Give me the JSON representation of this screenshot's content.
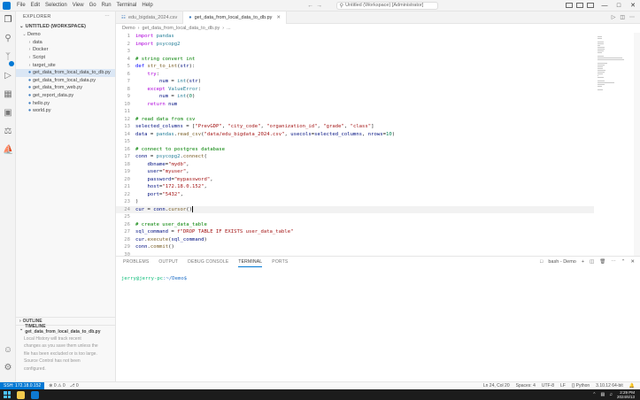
{
  "titlebar": {
    "menu": [
      "File",
      "Edit",
      "Selection",
      "View",
      "Go",
      "Run",
      "Terminal",
      "Help"
    ],
    "search": "Untitled (Workspace) [Administrator]"
  },
  "sidebar": {
    "header": "EXPLORER",
    "section": "UNTITLED (WORKSPACE)",
    "items": [
      {
        "label": "Demo",
        "indent": 1,
        "type": "folder-open"
      },
      {
        "label": "data",
        "indent": 2,
        "type": "folder"
      },
      {
        "label": "Docker",
        "indent": 2,
        "type": "folder"
      },
      {
        "label": "Script",
        "indent": 2,
        "type": "folder"
      },
      {
        "label": "target_site",
        "indent": 2,
        "type": "folder"
      },
      {
        "label": "get_data_from_local_data_to_db.py",
        "indent": 2,
        "type": "file",
        "selected": true
      },
      {
        "label": "get_data_from_local_data.py",
        "indent": 2,
        "type": "file"
      },
      {
        "label": "get_data_from_web.py",
        "indent": 2,
        "type": "file"
      },
      {
        "label": "get_report_data.py",
        "indent": 2,
        "type": "file"
      },
      {
        "label": "hello.py",
        "indent": 2,
        "type": "file"
      },
      {
        "label": "world.py",
        "indent": 2,
        "type": "file"
      }
    ],
    "outline": "OUTLINE",
    "timeline": "TIMELINE  get_data_from_local_data_to_db.py",
    "timeline_message": [
      "Local History will track recent",
      "changes as you save them unless the",
      "file has been excluded or is too large.",
      "Source Control has not been",
      "configured."
    ]
  },
  "tabs": [
    {
      "label": "edu_bigdata_2024.csv",
      "active": false
    },
    {
      "label": "get_data_from_local_data_to_db.py",
      "active": true
    }
  ],
  "breadcrumb": [
    "Demo",
    "get_data_from_local_data_to_db.py",
    "..."
  ],
  "code": [
    {
      "n": "1",
      "html": "<span class='c-kw'>import</span> <span class='c-mod'>pandas</span>"
    },
    {
      "n": "2",
      "html": "<span class='c-kw'>import</span> <span class='c-mod'>psycopg2</span>"
    },
    {
      "n": "3",
      "html": ""
    },
    {
      "n": "4",
      "html": "<span class='c-cm'># string convert int</span>"
    },
    {
      "n": "5",
      "html": "<span class='c-kw2'>def</span> <span class='c-fn'>str_to_int</span>(<span class='c-var'>str</span>):"
    },
    {
      "n": "6",
      "html": "    <span class='c-kw'>try</span>:"
    },
    {
      "n": "7",
      "html": "        <span class='c-var'>num</span> = <span class='c-mod'>int</span>(<span class='c-var'>str</span>)"
    },
    {
      "n": "8",
      "html": "    <span class='c-kw'>except</span> <span class='c-mod'>ValueError</span>:"
    },
    {
      "n": "9",
      "html": "        <span class='c-var'>num</span> = <span class='c-mod'>int</span>(<span class='c-num'>0</span>)"
    },
    {
      "n": "10",
      "html": "    <span class='c-kw'>return</span> <span class='c-var'>num</span>"
    },
    {
      "n": "11",
      "html": ""
    },
    {
      "n": "12",
      "html": "<span class='c-cm'># read data from csv</span>"
    },
    {
      "n": "13",
      "html": "<span class='c-var'>selected_columns</span> = [<span class='c-str'>\"PrevGDP\"</span>, <span class='c-str'>\"city_code\"</span>, <span class='c-str'>\"organization_id\"</span>, <span class='c-str'>\"grade\"</span>, <span class='c-str'>\"class\"</span>]"
    },
    {
      "n": "14",
      "html": "<span class='c-var'>data</span> = <span class='c-mod'>pandas</span>.<span class='c-fn'>read_csv</span>(<span class='c-str'>\"data/edu_bigdata_2024.csv\"</span>, <span class='c-var'>usecols</span>=<span class='c-var'>selected_columns</span>, <span class='c-var'>nrows</span>=<span class='c-num'>10</span>)"
    },
    {
      "n": "15",
      "html": ""
    },
    {
      "n": "16",
      "html": "<span class='c-cm'># connect to postgres database</span>"
    },
    {
      "n": "17",
      "html": "<span class='c-var'>conn</span> = <span class='c-mod'>psycopg2</span>.<span class='c-fn'>connect</span>("
    },
    {
      "n": "18",
      "html": "    <span class='c-var'>dbname</span>=<span class='c-str'>\"mydb\"</span>,"
    },
    {
      "n": "19",
      "html": "    <span class='c-var'>user</span>=<span class='c-str'>\"myuser\"</span>,"
    },
    {
      "n": "20",
      "html": "    <span class='c-var'>password</span>=<span class='c-str'>\"mypassword\"</span>,"
    },
    {
      "n": "21",
      "html": "    <span class='c-var'>host</span>=<span class='c-str'>\"172.18.0.152\"</span>,"
    },
    {
      "n": "22",
      "html": "    <span class='c-var'>port</span>=<span class='c-str'>\"5432\"</span>,"
    },
    {
      "n": "23",
      "html": ")"
    },
    {
      "n": "24",
      "html": "<span class='c-var'>cur</span> = <span class='c-var'>conn</span>.<span class='c-fn'>cursor</span>()<span class='cursor'></span>",
      "current": true
    },
    {
      "n": "25",
      "html": ""
    },
    {
      "n": "26",
      "html": "<span class='c-cm'># create user_data_table</span>"
    },
    {
      "n": "27",
      "html": "<span class='c-var'>sql_command</span> = <span class='c-str'>f\"DROP TABLE IF EXISTS user_data_table\"</span>"
    },
    {
      "n": "28",
      "html": "<span class='c-var'>cur</span>.<span class='c-fn'>execute</span>(<span class='c-var'>sql_command</span>)"
    },
    {
      "n": "29",
      "html": "<span class='c-var'>conn</span>.<span class='c-fn'>commit</span>()"
    },
    {
      "n": "30",
      "html": ""
    },
    {
      "n": "31",
      "html": "<span class='c-var'>sql_command</span> = <span class='c-str'>f'''</span>"
    }
  ],
  "panel": {
    "tabs": [
      "PROBLEMS",
      "OUTPUT",
      "DEBUG CONSOLE",
      "TERMINAL",
      "PORTS"
    ],
    "active_tab": "TERMINAL",
    "terminal_profile": "bash - Demo",
    "prompt_user": "jerry@jerry-pc",
    "prompt_path": ":~/Demo$"
  },
  "statusbar": {
    "remote": "SSH: 172.18.0.152",
    "problems": "⊗ 0 ⚠ 0",
    "ports": "⎇ 0",
    "right": [
      "Ln 24, Col 20",
      "Spaces: 4",
      "UTF-8",
      "LF",
      "{} Python",
      "3.10.12 64-bit"
    ]
  },
  "taskbar": {
    "time": "2:29 PM",
    "date": "2024/6/13"
  },
  "colors": {
    "accent": "#0078d4",
    "keyword": "#af00db",
    "comment": "#008000",
    "string": "#a31515"
  }
}
